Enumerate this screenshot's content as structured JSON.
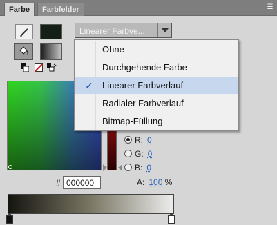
{
  "tabs": [
    {
      "label": "Farbe",
      "active": true
    },
    {
      "label": "Farbfelder",
      "active": false
    }
  ],
  "panel_menu_icon": "panel-menu-icon",
  "stroke": {
    "icon": "pencil-icon",
    "color": "#142017"
  },
  "fill": {
    "icon": "paint-bucket-icon",
    "gradient_start": "#1b1b1b",
    "gradient_end": "#c7c7c7"
  },
  "fill_type_select": {
    "value": "Linearer Farbve...",
    "options_open": true
  },
  "fill_type_menu": {
    "items": [
      {
        "label": "Ohne",
        "checked": false
      },
      {
        "label": "Durchgehende Farbe",
        "checked": false
      },
      {
        "label": "Linearer Farbverlauf",
        "checked": true
      },
      {
        "label": "Radialer Farbverlauf",
        "checked": false
      },
      {
        "label": "Bitmap-Füllung",
        "checked": false
      }
    ],
    "check_glyph": "✓"
  },
  "rgb": {
    "r": {
      "label": "R:",
      "value": "0",
      "selected": true
    },
    "g": {
      "label": "G:",
      "value": "0",
      "selected": false
    },
    "b": {
      "label": "B:",
      "value": "0",
      "selected": false
    }
  },
  "alpha": {
    "label": "A:",
    "value": "100",
    "unit": "%"
  },
  "hex": {
    "hash": "#",
    "value": "000000"
  },
  "gradient_ramp": {
    "stops": [
      "#151510",
      "#ececec"
    ]
  }
}
